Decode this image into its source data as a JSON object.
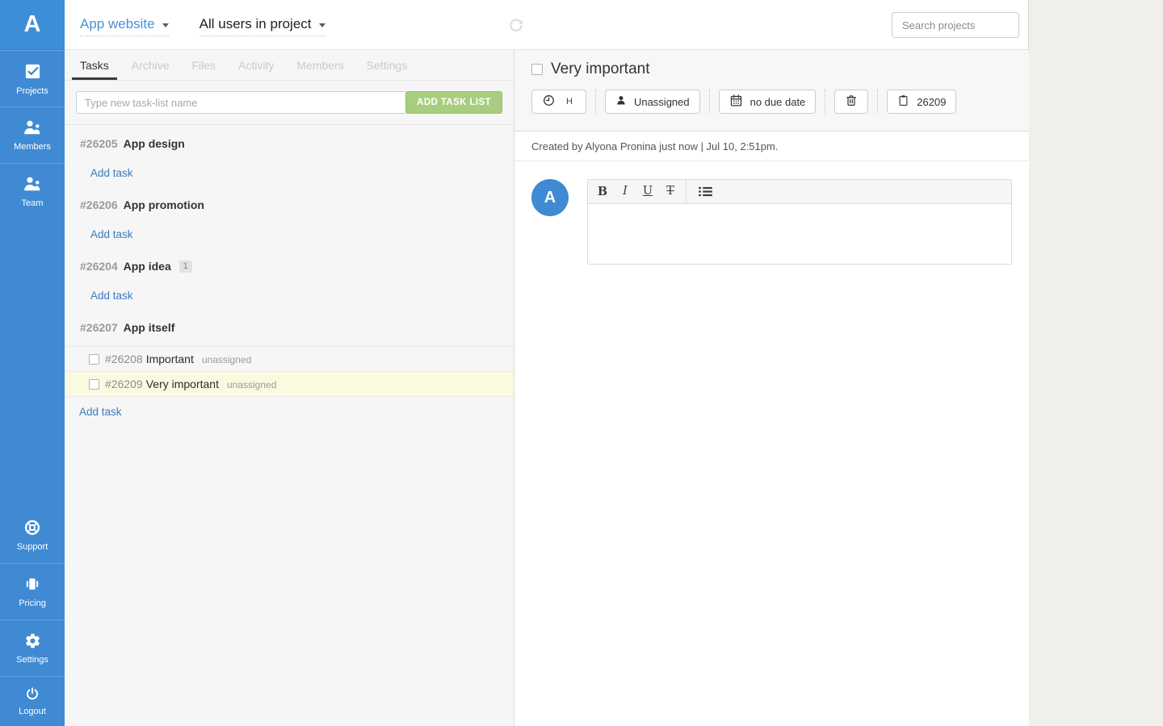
{
  "colors": {
    "sidebar_blue": "#3f8ad3",
    "accent_blue": "#4a90d9",
    "link_blue": "#3a7cbe",
    "add_list_green": "#a9cd80",
    "highlight_yellow": "#fcf9e1"
  },
  "sidebar": {
    "logo": "A",
    "items": [
      {
        "label": "Projects",
        "icon": "checkbox-icon"
      },
      {
        "label": "Members",
        "icon": "people-icon"
      },
      {
        "label": "Team",
        "icon": "people-icon"
      }
    ],
    "footer_items": [
      {
        "label": "Support",
        "icon": "lifering-icon"
      },
      {
        "label": "Pricing",
        "icon": "money-icon"
      },
      {
        "label": "Settings",
        "icon": "gear-icon"
      },
      {
        "label": "Logout",
        "icon": "power-icon"
      }
    ]
  },
  "topbar": {
    "project_selector": "App website",
    "user_filter": "All users in project",
    "search_placeholder": "Search projects"
  },
  "left_panel": {
    "tabs": [
      "Tasks",
      "Archive",
      "Files",
      "Activity",
      "Members",
      "Settings"
    ],
    "active_tab": "Tasks",
    "new_list_placeholder": "Type new task-list name",
    "add_list_button": "ADD TASK LIST",
    "add_task": "Add task",
    "lists": [
      {
        "id": "#26205",
        "name": "App design"
      },
      {
        "id": "#26206",
        "name": "App promotion"
      },
      {
        "id": "#26204",
        "name": "App idea",
        "badge": "1"
      },
      {
        "id": "#26207",
        "name": "App itself",
        "tasks": [
          {
            "id": "#26208",
            "name": "Important",
            "assignee": "unassigned",
            "selected": false
          },
          {
            "id": "#26209",
            "name": "Very important",
            "assignee": "unassigned",
            "selected": true
          }
        ]
      }
    ]
  },
  "task_detail": {
    "title": "Very important",
    "actions": {
      "time": "H",
      "assignee": "Unassigned",
      "due_date": "no due date",
      "task_number": "26209"
    },
    "created_line": "Created by Alyona Pronina just now | Jul 10, 2:51pm.",
    "avatar": "A",
    "editor": {
      "bold": "B",
      "italic": "I",
      "underline": "U",
      "strike": "T"
    }
  }
}
